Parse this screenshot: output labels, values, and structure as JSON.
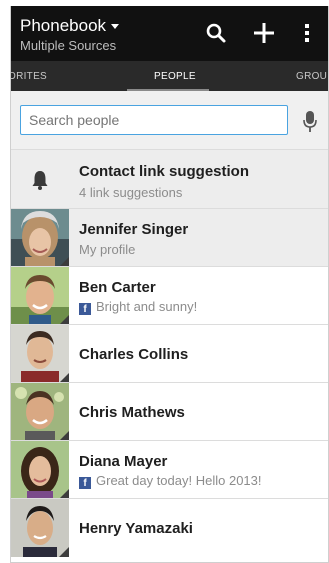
{
  "header": {
    "title": "Phonebook",
    "subtitle": "Multiple Sources",
    "icons": [
      "search-icon",
      "add-icon",
      "overflow-menu-icon"
    ]
  },
  "tabs": [
    {
      "label": "ORITES"
    },
    {
      "label": "PEOPLE"
    },
    {
      "label": "GROU"
    }
  ],
  "search": {
    "placeholder": "Search people",
    "value": ""
  },
  "suggestion": {
    "title": "Contact link suggestion",
    "subtitle": "4 link suggestions"
  },
  "contacts": [
    {
      "name": "Jennifer Singer",
      "status": "My profile"
    },
    {
      "name": "Ben Carter",
      "status": "Bright and sunny!"
    },
    {
      "name": "Charles Collins",
      "status": ""
    },
    {
      "name": "Chris Mathews",
      "status": ""
    },
    {
      "name": "Diana Mayer",
      "status": "Great day today! Hello 2013!"
    },
    {
      "name": "Henry Yamazaki",
      "status": ""
    }
  ],
  "colors": {
    "actionbar": "#111111",
    "tabbar": "#2a2a2a",
    "search_border": "#4aa3e0",
    "facebook": "#3b5998"
  }
}
